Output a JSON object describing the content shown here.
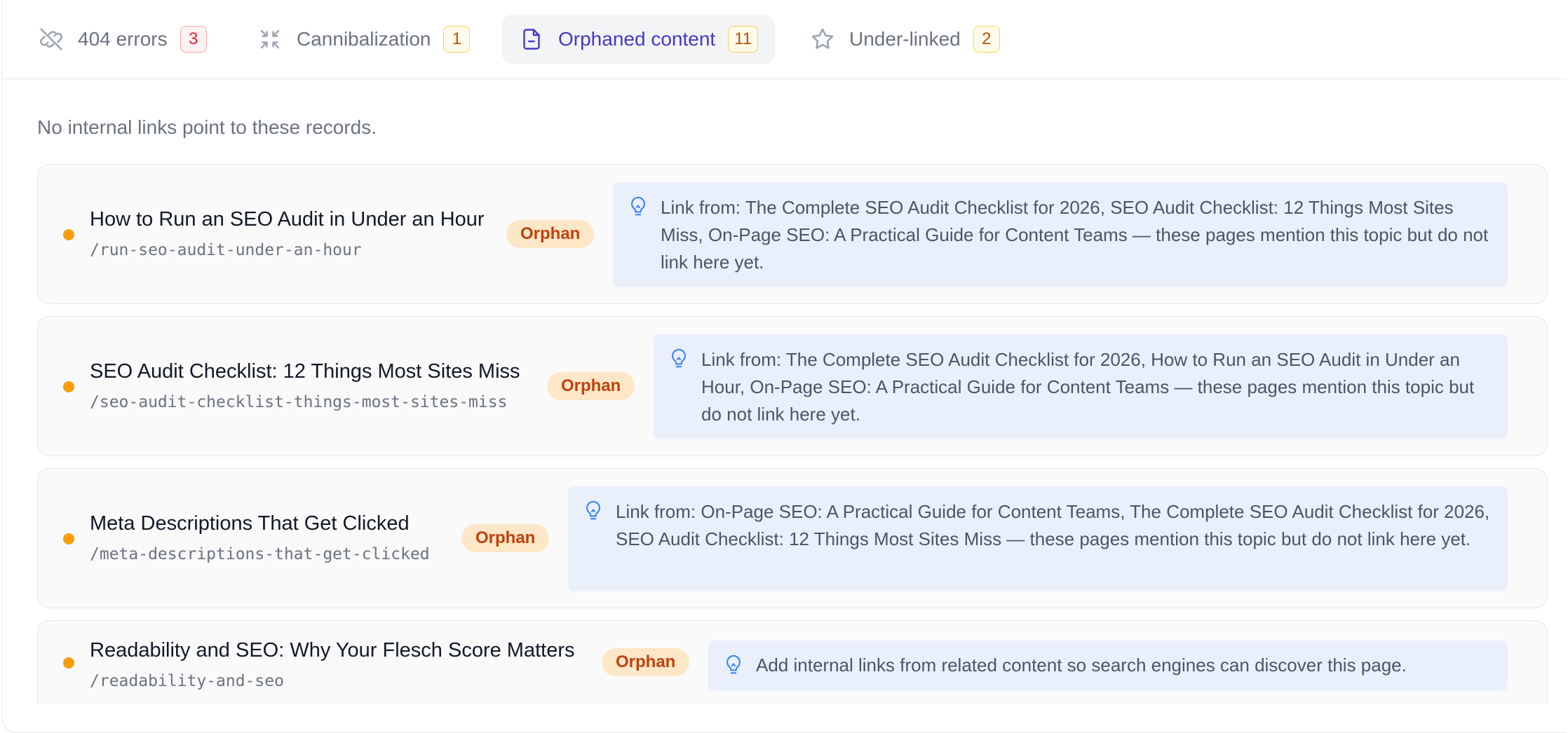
{
  "tabs": [
    {
      "label": "404 errors",
      "count": "3",
      "icon": "broken-link-icon"
    },
    {
      "label": "Cannibalization",
      "count": "1",
      "icon": "collapse-arrows-icon"
    },
    {
      "label": "Orphaned content",
      "count": "11",
      "icon": "document-icon"
    },
    {
      "label": "Under-linked",
      "count": "2",
      "icon": "star-icon"
    }
  ],
  "active_tab": "Orphaned content",
  "subtitle": "No internal links point to these records.",
  "rows": [
    {
      "title": "How to Run an SEO Audit in Under an Hour",
      "slug": "/run-seo-audit-under-an-hour",
      "badge": "Orphan",
      "hint": "Link from: The Complete SEO Audit Checklist for 2026, SEO Audit Checklist: 12 Things Most Sites Miss, On-Page SEO: A Practical Guide for Content Teams — these pages mention this topic but do not link here yet."
    },
    {
      "title": "SEO Audit Checklist: 12 Things Most Sites Miss",
      "slug": "/seo-audit-checklist-things-most-sites-miss",
      "badge": "Orphan",
      "hint": "Link from: The Complete SEO Audit Checklist for 2026, How to Run an SEO Audit in Under an Hour, On-Page SEO: A Practical Guide for Content Teams — these pages mention this topic but do not link here yet."
    },
    {
      "title": "Meta Descriptions That Get Clicked",
      "slug": "/meta-descriptions-that-get-clicked",
      "badge": "Orphan",
      "hint": "Link from: On-Page SEO: A Practical Guide for Content Teams, The Complete SEO Audit Checklist for 2026, SEO Audit Checklist: 12 Things Most Sites Miss — these pages mention this topic but do not link here yet."
    },
    {
      "title": "Readability and SEO: Why Your Flesch Score Matters",
      "slug": "/readability-and-seo",
      "badge": "Orphan",
      "hint": "Add internal links from related content so search engines can discover this page."
    }
  ],
  "colors": {
    "accent": "#4338ca",
    "orphan_dot": "#f59e0b",
    "badge_bg": "#fde7c7",
    "badge_text": "#c2410c",
    "hint_bg": "#eaf0fb",
    "hint_icon": "#3b82f6",
    "error_count": "#dc2626",
    "warning_count": "#b45309"
  }
}
